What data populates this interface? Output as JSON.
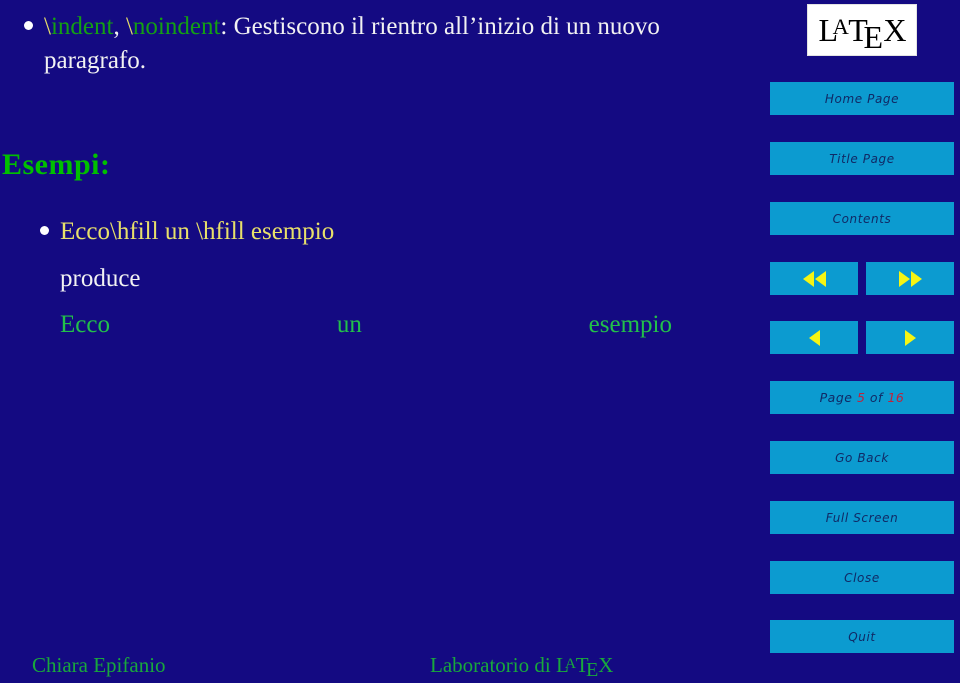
{
  "theme": {
    "background": "#140a82",
    "button_bg": "#0c9bd0",
    "button_text": "#102a66",
    "accent_green": "#00c000",
    "accent_yellow": "#e8e06a",
    "accent_white": "#f2f2f2",
    "arrow_yellow": "#f5f513",
    "page_number_color": "#c0223a",
    "logo_bg": "#ffffff"
  },
  "slide": {
    "bullets": [
      {
        "id": "indent-bullet",
        "segments": [
          {
            "text": "\\",
            "color": "yellow"
          },
          {
            "text": "indent",
            "color": "green"
          },
          {
            "text": ", ",
            "color": "white"
          },
          {
            "text": "\\",
            "color": "yellow"
          },
          {
            "text": "noindent",
            "color": "green"
          },
          {
            "text": ": Gestiscono il rientro all’inizio di un nuovo paragrafo.",
            "color": "white"
          }
        ],
        "plain": "\\indent, \\noindent: Gestiscono il rientro all’inizio di un nuovo paragrafo."
      }
    ],
    "heading": "Esempi:",
    "example": {
      "code_line": "Ecco\\hfill un \\hfill esempio",
      "produce_label": "produce",
      "output_words": [
        "Ecco",
        "un",
        "esempio"
      ]
    }
  },
  "footer": {
    "author": "Chiara Epifanio",
    "course_prefix": "Laboratorio di ",
    "course_logo": "LaTeX"
  },
  "nav": {
    "logo": {
      "name": "latex-logo",
      "l": "L",
      "a": "A",
      "t": "T",
      "e": "E",
      "x": "X"
    },
    "buttons": [
      {
        "id": "home",
        "label": "Home Page"
      },
      {
        "id": "title",
        "label": "Title Page"
      },
      {
        "id": "contents",
        "label": "Contents"
      },
      {
        "id": "goback",
        "label": "Go Back"
      },
      {
        "id": "fullscr",
        "label": "Full Screen"
      },
      {
        "id": "close",
        "label": "Close"
      },
      {
        "id": "quit",
        "label": "Quit"
      }
    ],
    "arrows": {
      "first": "first-page-double-left-arrow",
      "last": "last-page-double-right-arrow",
      "prev": "previous-page-left-arrow",
      "next": "next-page-right-arrow"
    },
    "page_indicator": {
      "prefix": "Page",
      "current": "5",
      "middle": "of",
      "total": "16"
    }
  }
}
